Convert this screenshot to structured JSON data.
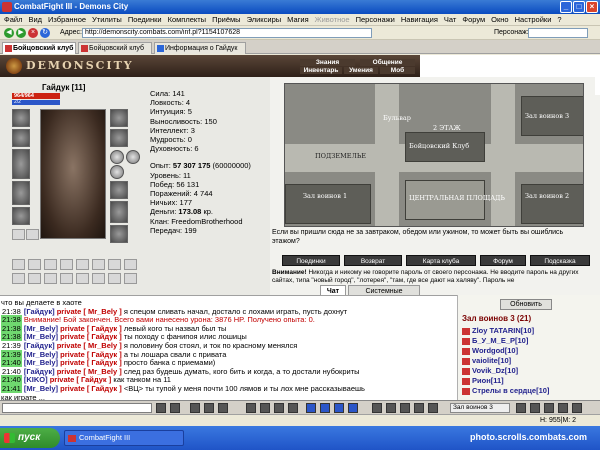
{
  "window": {
    "title": "CombatFight III - Demons City"
  },
  "menu": {
    "items": [
      "Файл",
      "Вид",
      "Избранное",
      "Утилиты",
      "Поединки",
      "Комплекты",
      "Приёмы",
      "Эликсиры",
      "Магия",
      "Животное",
      "Персонажи",
      "Навигация",
      "Чат",
      "Форум",
      "Окно",
      "Настройки",
      "?"
    ],
    "disabled_item": "Животное"
  },
  "address": {
    "label": "Адрес:",
    "url": "http://demonscity.combats.com/inf.pl?1154107628",
    "person_label": "Персонаж:"
  },
  "tabs": [
    {
      "label": "Бойцовский клуб",
      "active": true
    },
    {
      "label": "Бойцовский клуб",
      "active": false
    },
    {
      "label": "Информация о Гайдук",
      "active": false
    }
  ],
  "game": {
    "logo": "DEMONSCITY",
    "nav": {
      "knowledge": "Знания",
      "communication": "Общение",
      "inventory": "Инвентарь",
      "skills": "Умения",
      "mail": "Моб"
    }
  },
  "character": {
    "name": "Гайдук [11]",
    "hp": "964/964",
    "mp": "2/2",
    "stats": [
      "Сила: 141",
      "Ловкость: 4",
      "Интуиция: 5",
      "Выносливость: 150",
      "Интеллект: 3",
      "Мудрость: 0",
      "Духовность: 6"
    ],
    "exp_label": "Опыт:",
    "exp_value": "57 307 175",
    "exp_next": "(60000000)",
    "info": [
      "Уровень: 11",
      "Побед: 56 131",
      "Поражений: 4 744",
      "Ничьих: 177"
    ],
    "money_label": "Деньги:",
    "money_value": "173.08",
    "money_unit": "кр.",
    "clan": "Клан: FreedomBrotherhood",
    "transfers": "Передач: 199"
  },
  "map": {
    "labels": {
      "boulevard": "Бульвар",
      "floor2": "2 ЭТАЖ",
      "club": "Бойцовский Клуб",
      "dungeon": "ПОДЗЕМЕЛЬЕ",
      "square": "ЦЕНТРАЛЬНАЯ ПЛОЩАДЬ",
      "hall1": "Зал воинов 1",
      "hall2": "Зал воинов 2",
      "hall3": "Зал воинов 3"
    },
    "hint": "Если вы пришли сюда не за завтраком, обедом или ужином, то может быть вы ошиблись этажом?",
    "buttons": [
      "Поединки",
      "Возврат",
      "Карта клуба",
      "Форум",
      "Подсказка"
    ],
    "warning_bold": "Внимание!",
    "warning_text": "Никогда и никому не говорите пароль от своего персонажа. Не вводите пароль на других сайтах, типа \"новый город\", \"лотерея\", \"там, где все дают на халяву\". Пароль не"
  },
  "chat_tabs": [
    "Чат",
    "Системные сообщения"
  ],
  "chat": [
    {
      "time": "",
      "nick": "",
      "priv": "",
      "text": "что вы делаете в хаоте",
      "sys": false
    },
    {
      "time": "21:38",
      "nick": "[Гайдук]",
      "priv": "private [ Mr_Bely ]",
      "text": "я спецом сливать начал, достало с лохами играть, пусть дохнут",
      "sys": false
    },
    {
      "time": "21:38",
      "nick": "",
      "priv": "",
      "text": "Внимание! Бой закончен. Всего вами нанесено урона: 3876 HP. Получено опыта: 0.",
      "sys": true
    },
    {
      "time": "21:38",
      "nick": "[Mr_Bely]",
      "priv": "private [ Гайдук ]",
      "text": "левый кого ты назвал был ты",
      "sys": false
    },
    {
      "time": "21:38",
      "nick": "[Mr_Bely]",
      "priv": "private [ Гайдук ]",
      "text": "ты походу с фанипоя илис лошицы",
      "sys": false
    },
    {
      "time": "21:39",
      "nick": "[Гайдук]",
      "priv": "private [ Mr_Bely ]",
      "text": "я половину боя стоял, и ток по красному менялся",
      "sys": false
    },
    {
      "time": "21:39",
      "nick": "[Mr_Bely]",
      "priv": "private [ Гайдук ]",
      "text": "а ты лошара свали с привата",
      "sys": false
    },
    {
      "time": "21:40",
      "nick": "[Mr_Bely]",
      "priv": "private [ Гайдук ]",
      "text": "просто банка с приемами)",
      "sys": false
    },
    {
      "time": "21:40",
      "nick": "[Гайдук]",
      "priv": "private [ Mr_Bely ]",
      "text": "след раз будешь думать, кого бить и когда, а то достали нубокриты",
      "sys": false
    },
    {
      "time": "21:40",
      "nick": "[KIKO]",
      "priv": "private [ Гайдук ]",
      "text": "как танком на 11",
      "sys": false
    },
    {
      "time": "21:41",
      "nick": "[Mr_Bely]",
      "priv": "private [ Гайдук ]",
      "text": "<ВЦ> ты тупой у меня почти 100 лямов и ты лох мне рассказываешь",
      "sys": false
    },
    {
      "time": "",
      "nick": "",
      "priv": "",
      "text": "как играте ...",
      "sys": false
    }
  ],
  "online": {
    "refresh": "Обновить",
    "room": "Зал воинов 3 (21)",
    "users": [
      "Zloy TATARIN[10]",
      "Б_У_М_Е_Р[10]",
      "Wordgod[10]",
      "vaiolite[10]",
      "Vovik_Dz[10]",
      "Рион[11]",
      "Стрелы в сердце[10]"
    ]
  },
  "chat_bar": {
    "room": "Зал воинов 3"
  },
  "status": {
    "left": "",
    "right": "Н: 955|М: 2"
  },
  "taskbar": {
    "start": "пуск",
    "item": "CombatFight III",
    "watermark": "photo.scrolls.combats.com"
  }
}
